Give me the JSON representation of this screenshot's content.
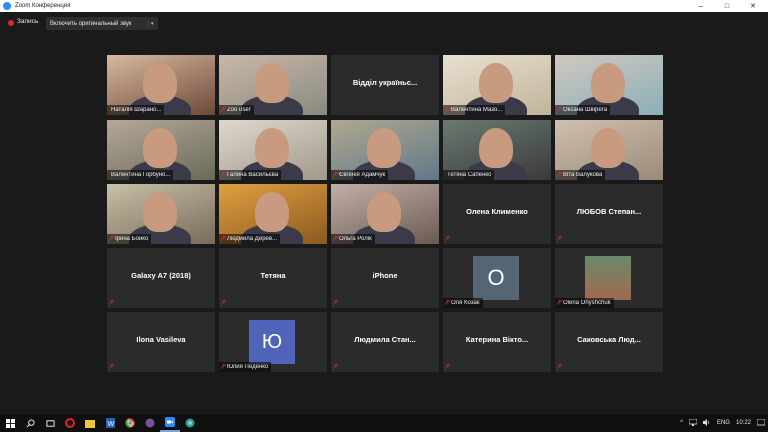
{
  "window": {
    "title": "Zoom Конференция",
    "controls": [
      "–",
      "□",
      "✕"
    ]
  },
  "toolbar": {
    "record_label": "Запись",
    "original_sound_label": "Включить оригинальный звук",
    "dropdown_glyph": "▾"
  },
  "participants": [
    {
      "name": "Наталія Шарано...",
      "video": true,
      "muted": false,
      "active": true
    },
    {
      "name": "Zoo user",
      "video": true,
      "muted": true
    },
    {
      "name": "Відділ україньс...",
      "video": false,
      "muted": false
    },
    {
      "name": "Валентина Мазо...",
      "video": true,
      "muted": true
    },
    {
      "name": "Оксана Швірега",
      "video": true,
      "muted": true
    },
    {
      "name": "Валентина Горбуно...",
      "video": true,
      "muted": false
    },
    {
      "name": "Галина Васильєва",
      "video": true,
      "muted": true
    },
    {
      "name": "Євгенія Адамчук",
      "video": true,
      "muted": true
    },
    {
      "name": "Тетяна Сапенко",
      "video": true,
      "muted": false
    },
    {
      "name": "Віта Валукова",
      "video": true,
      "muted": true
    },
    {
      "name": "Ірина Бойко",
      "video": true,
      "muted": true
    },
    {
      "name": "Людмила Дерев...",
      "video": true,
      "muted": true
    },
    {
      "name": "Ольга Ролік",
      "video": true,
      "muted": true
    },
    {
      "name": "Олена Клименко",
      "video": false,
      "muted": true
    },
    {
      "name": "ЛЮБОВ Степан...",
      "video": false,
      "muted": true
    },
    {
      "name": "Galaxy A7 (2018)",
      "video": false,
      "muted": true
    },
    {
      "name": "Тетяна",
      "video": false,
      "muted": true
    },
    {
      "name": "iPhone",
      "video": false,
      "muted": true
    },
    {
      "name": "Оля Козак",
      "video": false,
      "muted": true,
      "avatar_letter": "O"
    },
    {
      "name": "Olena Onyshchuk",
      "video": false,
      "muted": true,
      "avatar_photo": true
    },
    {
      "name": "Ilona Vasileva",
      "video": false,
      "muted": true
    },
    {
      "name": "Юлия Педенко",
      "video": false,
      "muted": true,
      "avatar_letter": "Ю"
    },
    {
      "name": "Людмила Стан...",
      "video": false,
      "muted": true
    },
    {
      "name": "Катерина Вікто...",
      "video": false,
      "muted": true
    },
    {
      "name": "Саковська Люд...",
      "video": false,
      "muted": true
    }
  ],
  "taskbar": {
    "icons": [
      "windows-icon",
      "search-icon",
      "task-view-icon",
      "opera-icon",
      "file-explorer-icon",
      "word-icon",
      "chrome-icon",
      "viber-icon",
      "zoom-icon",
      "edge-icon"
    ]
  },
  "tray": {
    "chevron": "^",
    "language": "ENG",
    "time": "10:22"
  },
  "colors": {
    "active_speaker": "#a6d84a",
    "mute": "#e02828",
    "tile_bg": "#2b2b2b",
    "background": "#1a1a1a"
  }
}
